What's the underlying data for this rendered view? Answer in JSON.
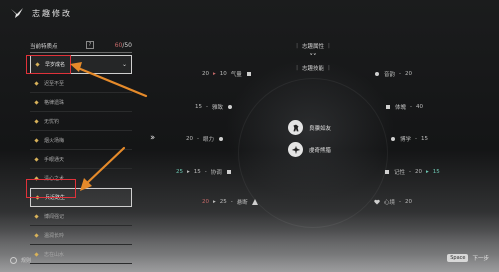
{
  "header": {
    "title": "志趣修改"
  },
  "panel": {
    "label": "当前特质点",
    "help": "?",
    "points_current": "60",
    "points_total": "/50"
  },
  "list": {
    "items": [
      {
        "label": "早岁成名"
      },
      {
        "label": "迟至不至"
      },
      {
        "label": "格律遗珠"
      },
      {
        "label": "无忧钓"
      },
      {
        "label": "烟火场梅"
      },
      {
        "label": "手眼通天"
      },
      {
        "label": "清心之术"
      },
      {
        "label": "兵近路生"
      },
      {
        "label": "博闻强记"
      },
      {
        "label": "温润长吟"
      },
      {
        "label": "志在山水"
      }
    ]
  },
  "center": {
    "tab1": "志趣属性",
    "tab2": "志趣技能",
    "chevrons": "˅˅"
  },
  "stats": {
    "qixiang": {
      "base": "20",
      "arrow": "▸",
      "bonus": "10",
      "label": "气量"
    },
    "yinyun": {
      "label": "音韵",
      "value": "20"
    },
    "moyi": {
      "value": "15",
      "label": "雅致"
    },
    "tiyu": {
      "label": "体魄",
      "value": "40"
    },
    "yanli": {
      "value": "20",
      "label": "眼力"
    },
    "boxue": {
      "label": "博学",
      "value": "15"
    },
    "xietiao": {
      "base": "25",
      "bonus": "15",
      "label": "协调"
    },
    "jiyi": {
      "label": "记性",
      "base": "20",
      "bonus": "15"
    },
    "shenyan": {
      "bonus": "20",
      "base": "25",
      "label": "悬断"
    },
    "xinjing": {
      "label": "心境",
      "value": "20"
    }
  },
  "skills": [
    {
      "label": "良骥如友"
    },
    {
      "label": "虔奇熊腊"
    }
  ],
  "footer": {
    "left_label": "规则",
    "key": "Space",
    "next_label": "下一步"
  },
  "colors": {
    "accent_red": "#c86a6a",
    "accent_green": "#6ec9b4",
    "marker_red": "#e0323a"
  }
}
